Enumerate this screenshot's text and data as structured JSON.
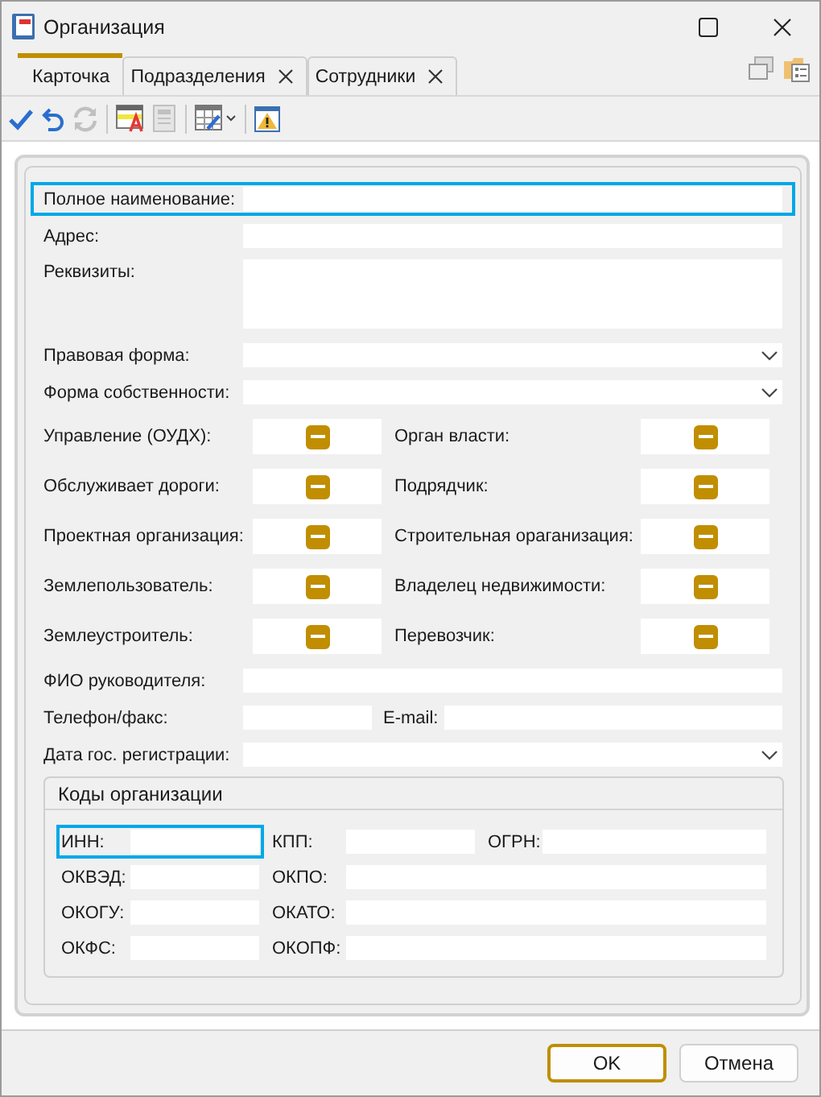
{
  "window": {
    "title": "Организация"
  },
  "tabs": [
    {
      "label": "Карточка",
      "selected": true,
      "closable": false
    },
    {
      "label": "Подразделения",
      "selected": false,
      "closable": true
    },
    {
      "label": "Сотрудники",
      "selected": false,
      "closable": true
    }
  ],
  "toolbar": [
    {
      "kind": "check",
      "disabled": false
    },
    {
      "kind": "undo",
      "disabled": false
    },
    {
      "kind": "refresh",
      "disabled": true
    },
    {
      "kind": "sep"
    },
    {
      "kind": "table-text",
      "disabled": false
    },
    {
      "kind": "document",
      "disabled": true
    },
    {
      "kind": "sep"
    },
    {
      "kind": "grid-edit",
      "disabled": false
    },
    {
      "kind": "sep"
    },
    {
      "kind": "warning",
      "disabled": false
    }
  ],
  "form": {
    "fields": [
      {
        "label": "Полное наименование:",
        "kind": "text",
        "focused": true
      },
      {
        "label": "Адрес:",
        "kind": "text",
        "focused": false
      },
      {
        "label": "Реквизиты:",
        "kind": "textarea",
        "focused": false
      },
      {
        "label": "Правовая форма:",
        "kind": "dropdown",
        "focused": false
      },
      {
        "label": "Форма собственности:",
        "kind": "dropdown",
        "focused": false
      }
    ],
    "flags": [
      {
        "label": "Управление (ОУДХ):",
        "indeterminate": true
      },
      {
        "label": "Орган власти:",
        "indeterminate": true
      },
      {
        "label": "Обслуживает дороги:",
        "indeterminate": true
      },
      {
        "label": "Подрядчик:",
        "indeterminate": true
      },
      {
        "label": "Проектная организация:",
        "indeterminate": true
      },
      {
        "label": "Строительная ораганизация:",
        "indeterminate": true
      },
      {
        "label": "Землепользователь:",
        "indeterminate": true
      },
      {
        "label": "Владелец недвижимости:",
        "indeterminate": true
      },
      {
        "label": "Землеустроитель:",
        "indeterminate": true
      },
      {
        "label": "Перевозчик:",
        "indeterminate": true
      }
    ],
    "fields_after": [
      {
        "label": "ФИО руководителя:",
        "kind": "text",
        "focused": false
      },
      {
        "label": "Телефон/факс:",
        "kind": "pair",
        "second_label": "E-mail:",
        "focused": false
      },
      {
        "label": "Дата гос. регистрации:",
        "kind": "dropdown",
        "focused": false
      }
    ],
    "codes": {
      "title": "Коды организации",
      "rows": [
        [
          {
            "label": "ИНН:",
            "focused": true
          },
          {
            "label": "КПП:",
            "focused": false
          },
          {
            "label": "ОГРН:",
            "focused": false
          }
        ],
        [
          {
            "label": "ОКВЭД:",
            "focused": false
          },
          {
            "label": "ОКПО:",
            "focused": false
          }
        ],
        [
          {
            "label": "ОКОГУ:",
            "focused": false
          },
          {
            "label": "ОКАТО:",
            "focused": false
          }
        ],
        [
          {
            "label": "ОКФС:",
            "focused": false
          },
          {
            "label": "ОКОПФ:",
            "focused": false
          }
        ]
      ]
    }
  },
  "buttons": [
    {
      "label": "OK",
      "default": true
    },
    {
      "label": "Отмена",
      "default": false
    }
  ]
}
